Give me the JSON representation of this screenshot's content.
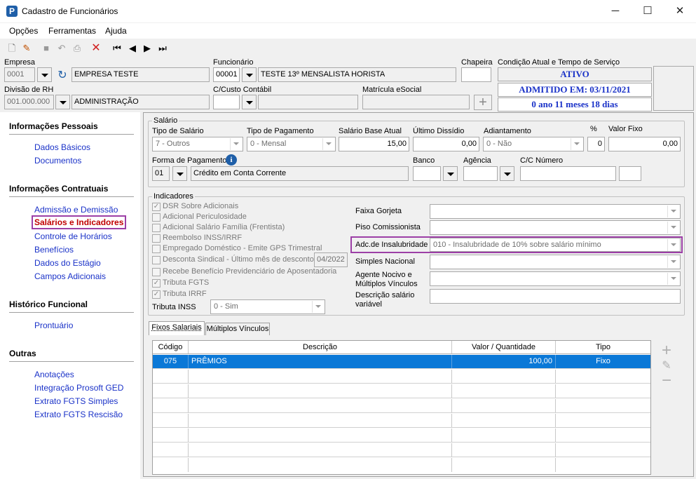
{
  "window": {
    "title": "Cadastro de Funcionários",
    "app_icon": "P",
    "minimize": "─",
    "maximize": "☐",
    "close": "✕"
  },
  "menu": [
    "Opções",
    "Ferramentas",
    "Ajuda"
  ],
  "header": {
    "empresa_label": "Empresa",
    "empresa_code": "0001",
    "empresa_name": "EMPRESA TESTE",
    "funcionario_label": "Funcionário",
    "funcionario_code": "00001",
    "funcionario_name": "TESTE 13º MENSALISTA HORISTA",
    "chapeira_label": "Chapeira",
    "chapeira_value": "",
    "divisao_label": "Divisão de RH",
    "divisao_code": "001.000.000",
    "divisao_name": "ADMINISTRAÇÃO",
    "ccusto_label": "C/Custo Contábil",
    "matricula_label": "Matrícula eSocial",
    "condicao_label": "Condição Atual e Tempo de Serviço",
    "status": "ATIVO",
    "admitido": "ADMITIDO EM: 03/11/2021",
    "tempo": "0 ano 11 meses 18 dias"
  },
  "sidebar": {
    "sections": [
      {
        "title": "Informações Pessoais",
        "items": [
          "Dados Básicos",
          "Documentos"
        ]
      },
      {
        "title": "Informações Contratuais",
        "items": [
          "Admissão e Demissão",
          "Salários e Indicadores",
          "Controle de Horários",
          "Benefícios",
          "Dados do Estágio",
          "Campos Adicionais"
        ]
      },
      {
        "title": "Histórico Funcional",
        "items": [
          "Prontuário"
        ]
      },
      {
        "title": "Outras",
        "items": [
          "Anotações",
          "Integração Prosoft GED",
          "Extrato FGTS Simples",
          "Extrato FGTS Rescisão"
        ]
      }
    ],
    "active": "Salários e Indicadores"
  },
  "salario": {
    "group_title": "Salário",
    "tipo_salario_label": "Tipo de Salário",
    "tipo_salario_value": "7 - Outros",
    "tipo_pagamento_label": "Tipo de Pagamento",
    "tipo_pagamento_value": "0 - Mensal",
    "salario_base_label": "Salário Base Atual",
    "salario_base_value": "15,00",
    "ultimo_dissidio_label": "Último Dissídio",
    "ultimo_dissidio_value": "0,00",
    "adiantamento_label": "Adiantamento",
    "adiantamento_value": "0 - Não",
    "pct_label": "%",
    "pct_value": "0",
    "valor_fixo_label": "Valor Fixo",
    "valor_fixo_value": "0,00",
    "forma_pagamento_label": "Forma de Pagamento",
    "forma_pagamento_code": "01",
    "forma_pagamento_value": "Crédito em Conta Corrente",
    "banco_label": "Banco",
    "agencia_label": "Agência",
    "cc_label": "C/C Número"
  },
  "indicadores": {
    "group_title": "Indicadores",
    "checks": [
      {
        "label": "DSR Sobre Adicionais",
        "checked": true
      },
      {
        "label": "Adicional Periculosidade",
        "checked": false
      },
      {
        "label": "Adicional Salário Família (Frentista)",
        "checked": false
      },
      {
        "label": "Reembolso INSS/IRRF",
        "checked": false
      },
      {
        "label": "Empregado Doméstico - Emite GPS Trimestral",
        "checked": false
      },
      {
        "label": "Desconta Sindical - Último mês de desconto",
        "checked": false
      },
      {
        "label": "Recebe Benefício Previdenciário de Aposentadoria",
        "checked": false
      },
      {
        "label": "Tributa FGTS",
        "checked": true
      },
      {
        "label": "Tributa IRRF",
        "checked": true
      }
    ],
    "desconto_mes": "04/2022",
    "tributa_inss_label": "Tributa INSS",
    "tributa_inss_value": "0 - Sim",
    "faixa_gorjeta_label": "Faixa Gorjeta",
    "piso_label": "Piso Comissionista",
    "insalubridade_label": "Adc.de Insalubridade",
    "insalubridade_value": "010 - Insalubridade de 10% sobre salário mínimo",
    "simples_label": "Simples Nacional",
    "agente_label_1": "Agente Nocivo e",
    "agente_label_2": "Múltiplos Vínculos",
    "descricao_label_1": "Descrição salário",
    "descricao_label_2": "variável"
  },
  "tabs": [
    "Fixos Salariais",
    "Múltiplos Vínculos"
  ],
  "table": {
    "columns": [
      "Código",
      "Descrição",
      "Valor / Quantidade",
      "Tipo"
    ],
    "rows": [
      {
        "codigo": "075",
        "descricao": "PRÊMIOS",
        "valor": "100,00",
        "tipo": "Fixo"
      }
    ]
  },
  "side_buttons": {
    "add": "+",
    "edit": "✎",
    "remove": "−"
  }
}
